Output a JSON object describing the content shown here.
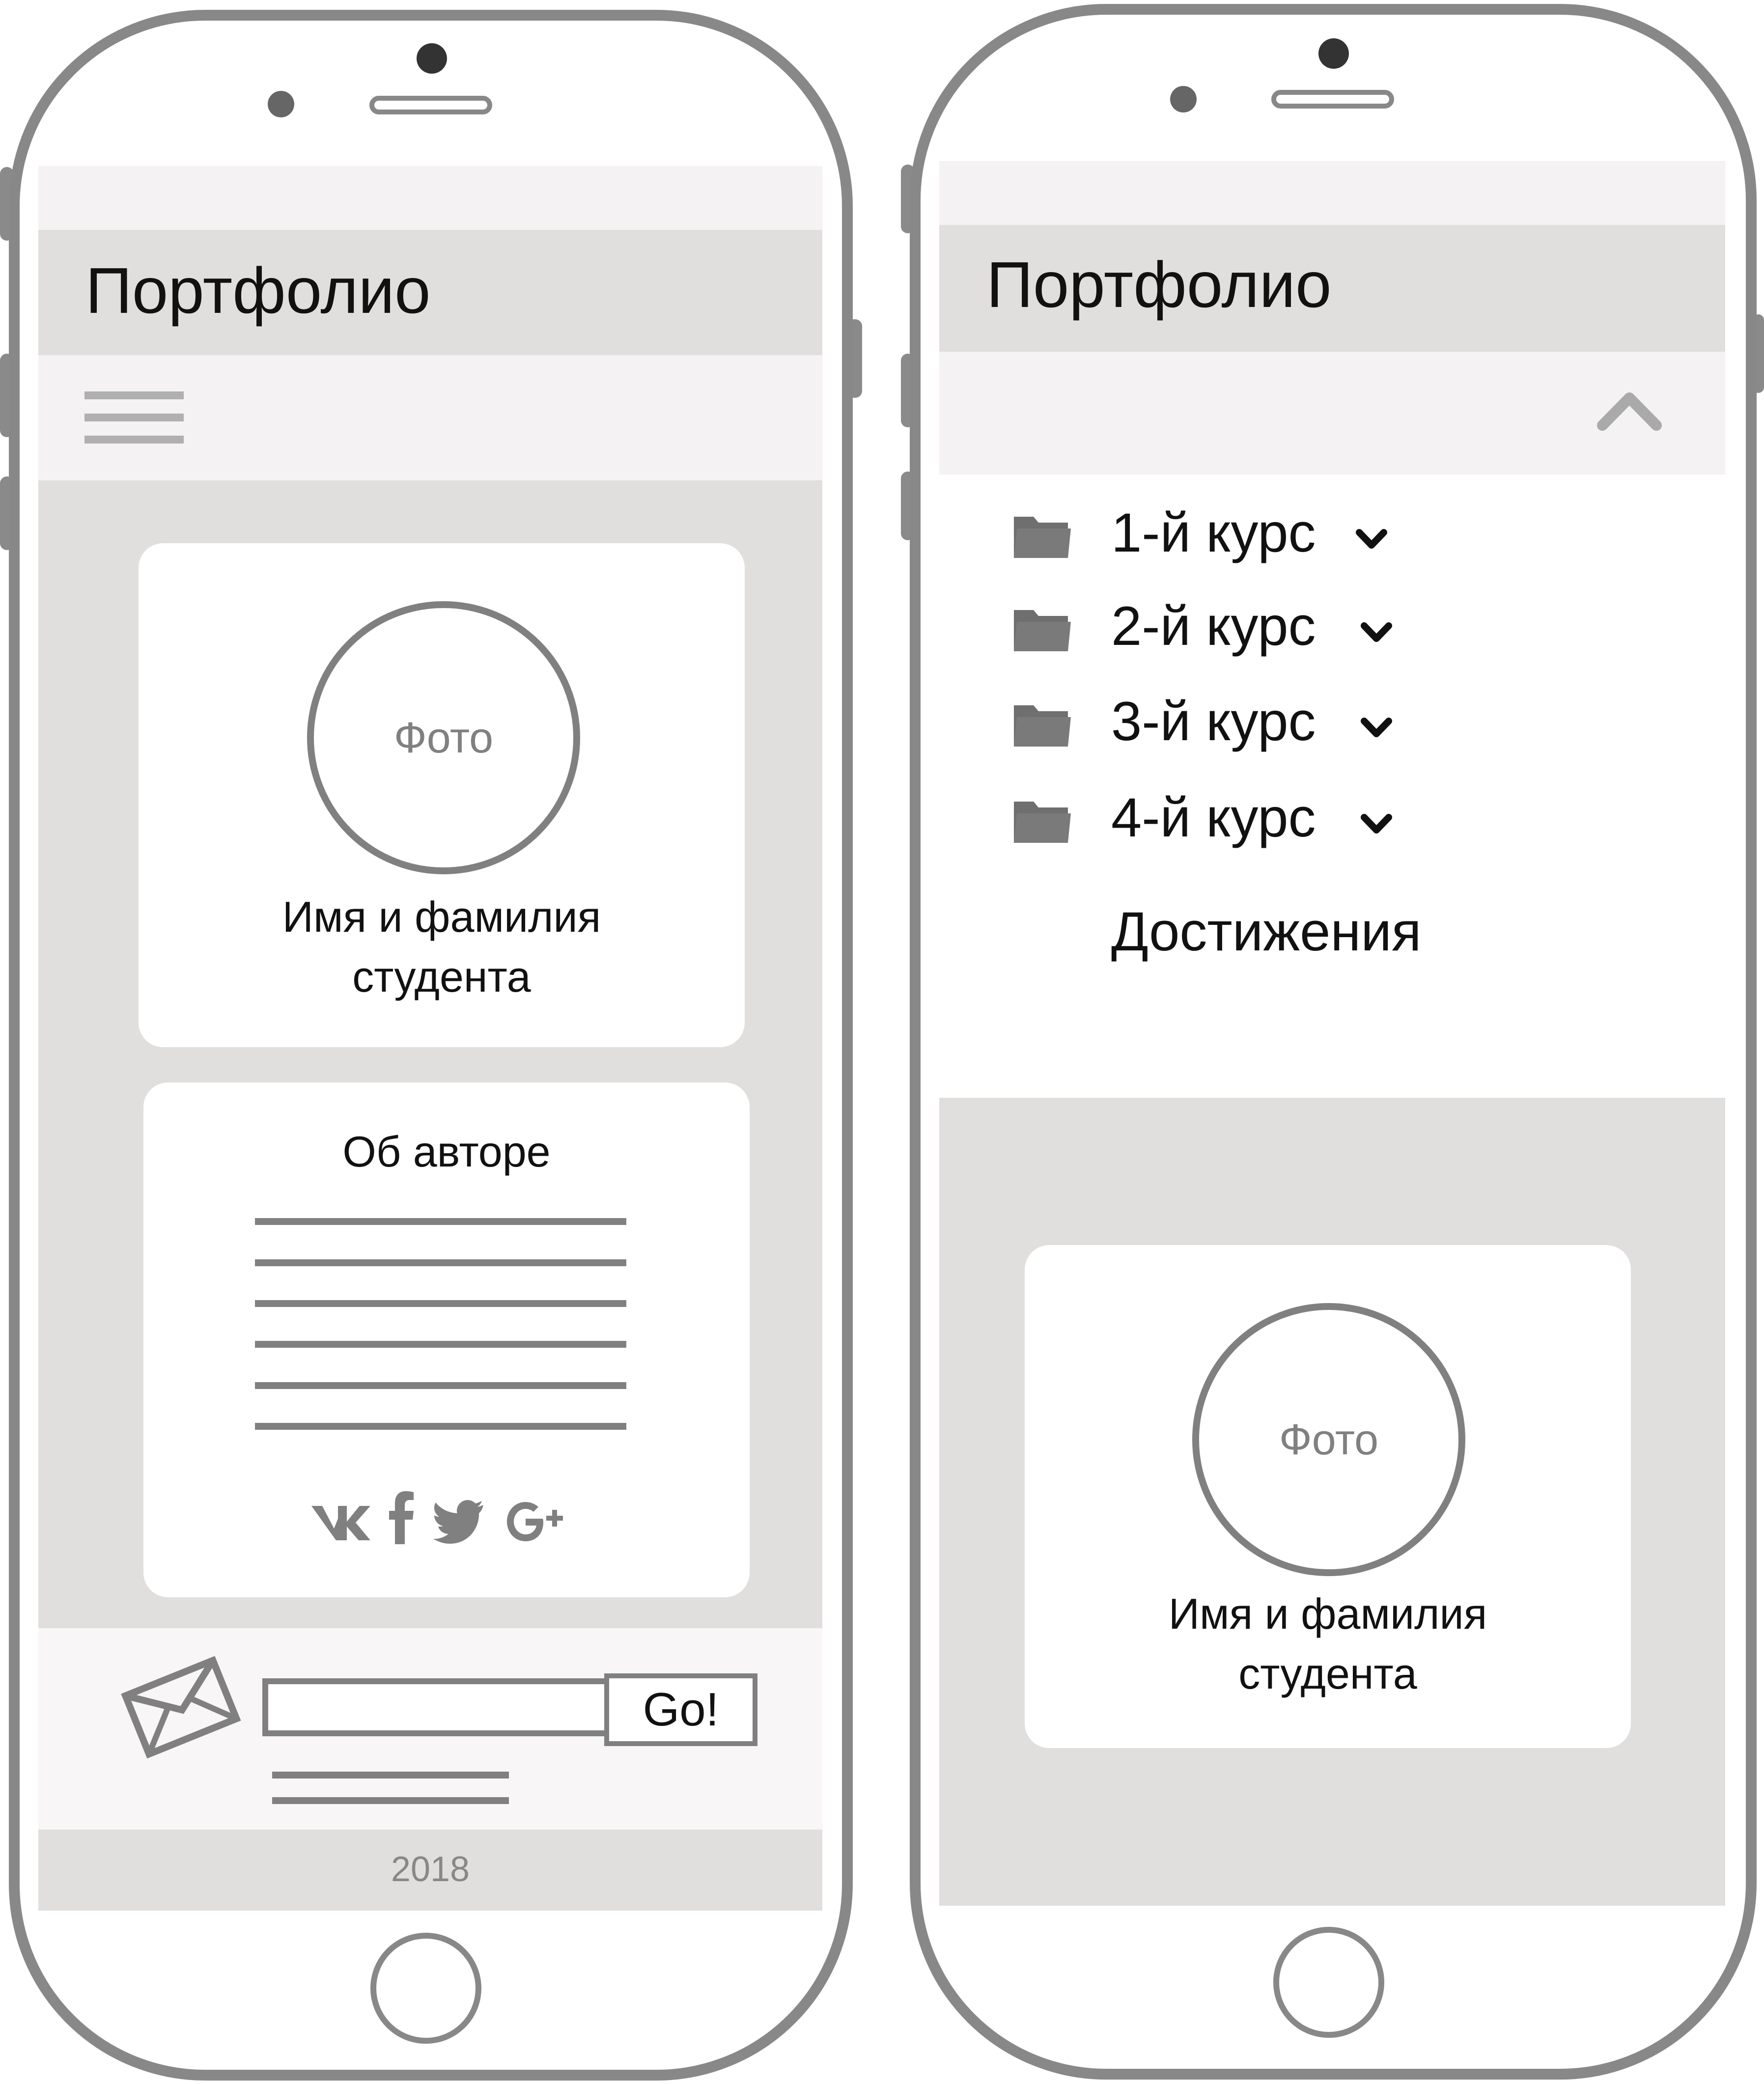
{
  "left_phone": {
    "header": {
      "title": "Портфолио"
    },
    "menu": {
      "icon": "hamburger-menu-icon"
    },
    "profile_card": {
      "photo_label": "Фото",
      "name_line1": "Имя и фамилия",
      "name_line2": "студента"
    },
    "about_card": {
      "title": "Об авторе",
      "social_icons": [
        "vk-icon",
        "facebook-icon",
        "twitter-icon",
        "google-plus-icon"
      ]
    },
    "subscribe": {
      "icon": "envelope-icon",
      "input_value": "",
      "button_label": "Go!"
    },
    "footer": {
      "year": "2018"
    }
  },
  "right_phone": {
    "header": {
      "title": "Портфолио"
    },
    "menu": {
      "toggle_icon": "chevron-up-icon",
      "items": [
        {
          "label": "1-й курс",
          "icon": "folder-icon"
        },
        {
          "label": "2-й курс",
          "icon": "folder-icon"
        },
        {
          "label": "3-й курс",
          "icon": "folder-icon"
        },
        {
          "label": "4-й курс",
          "icon": "folder-icon"
        }
      ],
      "achievements_label": "Достижения"
    },
    "profile_card": {
      "photo_label": "Фото",
      "name_line1": "Имя и фамилия",
      "name_line2": "студента"
    }
  },
  "colors": {
    "frame": "#888888",
    "header_bg": "#e1dfde",
    "light_bg": "#f4f2f2",
    "content_bg": "#e1dfde",
    "card_bg": "#ffffff",
    "lines": "#808080"
  }
}
